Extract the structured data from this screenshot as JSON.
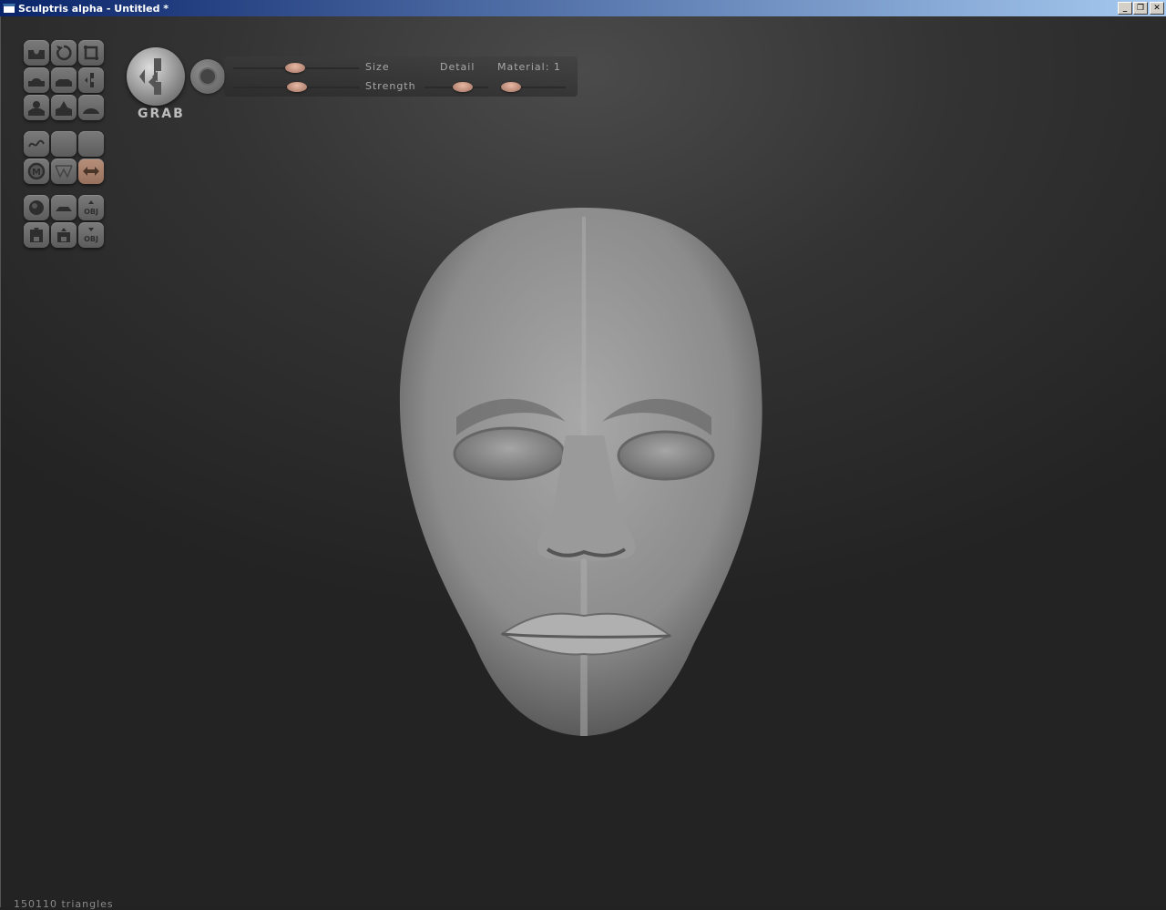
{
  "window": {
    "title": "Sculptris alpha - Untitled *",
    "buttons": [
      "minimize",
      "restore",
      "close"
    ]
  },
  "tools": {
    "group1": [
      {
        "icon": "draw-icon"
      },
      {
        "icon": "rotate-icon"
      },
      {
        "icon": "crop-icon"
      },
      {
        "icon": "inflate-icon"
      },
      {
        "icon": "flatten-icon"
      },
      {
        "icon": "grab-icon"
      },
      {
        "icon": "pinch-icon"
      },
      {
        "icon": "crease-icon"
      },
      {
        "icon": "smooth-icon"
      }
    ],
    "group2": [
      {
        "icon": "stroke-icon"
      },
      {
        "icon": "blank-icon"
      },
      {
        "icon": "blank-icon"
      },
      {
        "icon": "mask-icon"
      },
      {
        "icon": "wireframe-icon"
      },
      {
        "icon": "symmetry-icon",
        "active": true
      }
    ],
    "group3": [
      {
        "icon": "sphere-icon"
      },
      {
        "icon": "plane-icon"
      },
      {
        "icon": "import-obj-icon",
        "label": "OBJ"
      },
      {
        "icon": "save-icon"
      },
      {
        "icon": "open-icon"
      },
      {
        "icon": "export-obj-icon",
        "label": "OBJ"
      }
    ]
  },
  "brush": {
    "name": "GRAB",
    "size_label": "Size",
    "strength_label": "Strength",
    "detail_label": "Detail",
    "material_label": "Material: 1",
    "size": 0.49,
    "strength": 0.51,
    "detail": 0.6,
    "material": 0.17
  },
  "status": {
    "triangles": "150110 triangles"
  },
  "colors": {
    "accent": "#b8907a",
    "background": "#2b2b2b"
  }
}
